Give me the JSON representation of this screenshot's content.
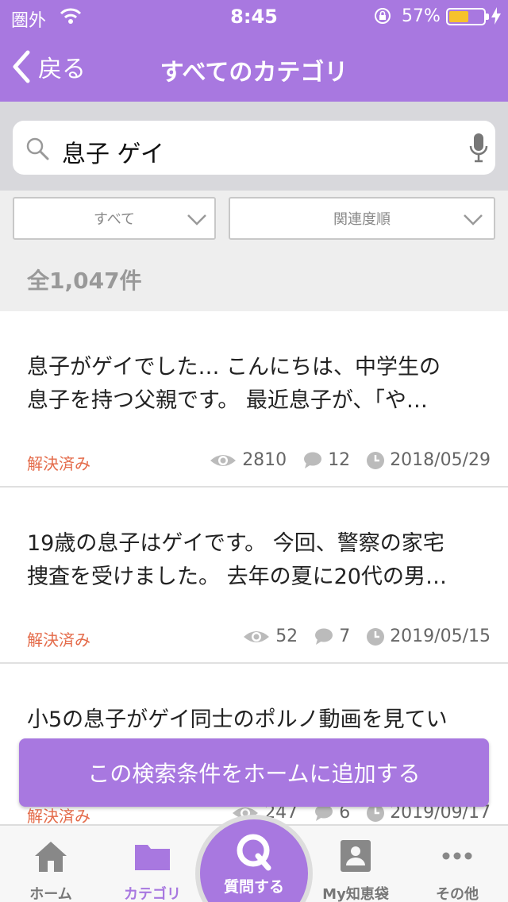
{
  "status_bar": {
    "carrier": "圏外",
    "time": "8:45",
    "battery": "57%",
    "battery_level": 0.57
  },
  "nav": {
    "back_label": "戻る",
    "title": "すべてのカテゴリ"
  },
  "search": {
    "query": "息子 ゲイ"
  },
  "filters": {
    "category": "すべて",
    "sort": "関連度順"
  },
  "result_count": "全1,047件",
  "results": [
    {
      "line1": "息子がゲイでした… こんにちは、中学生の",
      "line2": "息子を持つ父親です。 最近息子が、「や…",
      "status": "解決済み",
      "views": "2810",
      "answers": "12",
      "date": "2018/05/29"
    },
    {
      "line1": "19歳の息子はゲイです。 今回、警察の家宅",
      "line2": "捜査を受けました。 去年の夏に20代の男…",
      "status": "解決済み",
      "views": "52",
      "answers": "7",
      "date": "2019/05/15"
    },
    {
      "line1": "小5の息子がゲイ同士のポルノ動画を見てい",
      "line2": "",
      "status": "解決済み",
      "views": "247",
      "answers": "6",
      "date": "2019/09/17"
    }
  ],
  "add_button": "この検索条件をホームに追加する",
  "tabbar": {
    "home": "ホーム",
    "category": "カテゴリ",
    "ask": "質問する",
    "mybox": "My知恵袋",
    "other": "その他"
  },
  "colors": {
    "accent": "#a878e0",
    "solved": "#e46b4a",
    "battery": "#f6c22c"
  }
}
